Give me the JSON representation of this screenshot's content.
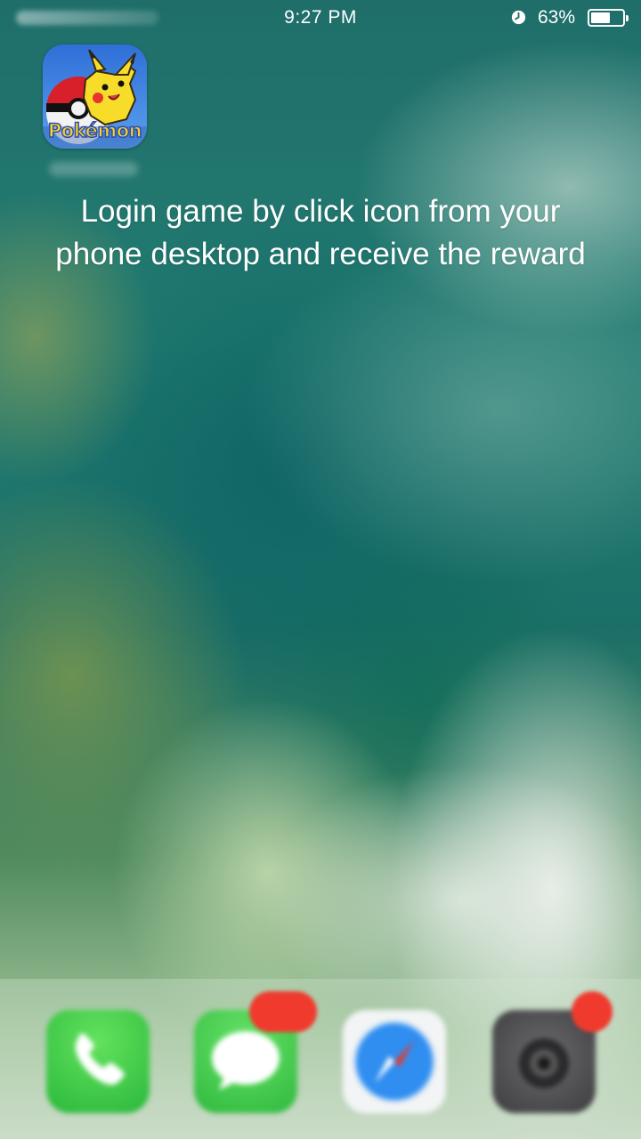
{
  "status_bar": {
    "time": "9:27 PM",
    "battery_percent_label": "63%",
    "battery_level": 0.63,
    "alarm_icon": "alarm-clock-icon"
  },
  "home_screen": {
    "app_icon": {
      "name_on_icon": "Pokémon",
      "icon": "pokemon-pikachu-app-icon"
    },
    "hint_line_1": "Login game by click icon from your",
    "hint_line_2": "phone desktop and receive the reward"
  },
  "dock": {
    "apps": [
      {
        "icon": "phone-icon"
      },
      {
        "icon": "messages-icon"
      },
      {
        "icon": "safari-icon"
      },
      {
        "icon": "camera-icon"
      }
    ]
  },
  "colors": {
    "badge": "#f03a2e",
    "text": "#ffffff"
  }
}
